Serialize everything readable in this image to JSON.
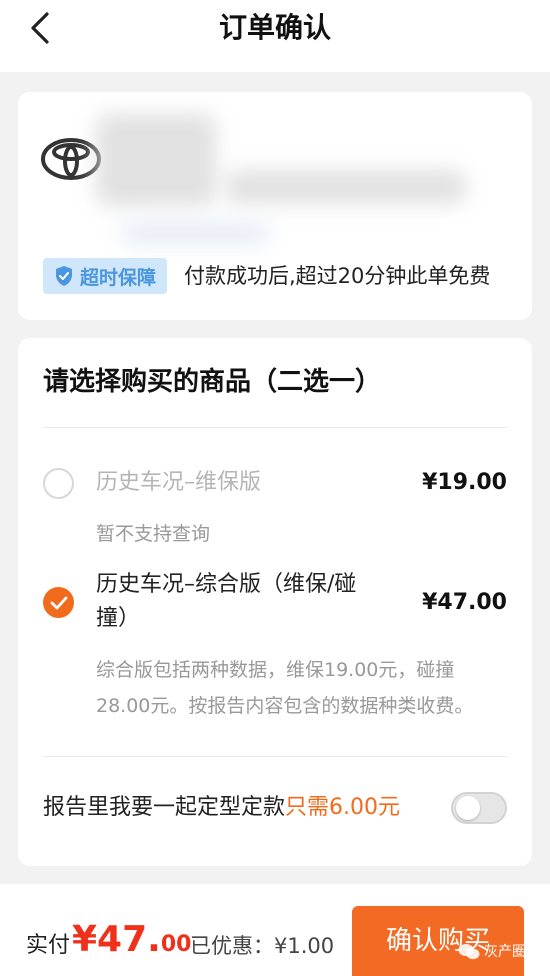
{
  "header": {
    "title": "订单确认"
  },
  "product": {
    "guarantee_badge": "超时保障",
    "guarantee_desc": "付款成功后,超过20分钟此单免费"
  },
  "selection": {
    "title": "请选择购买的商品（二选一）",
    "options": [
      {
        "name": "历史车况–维保版",
        "price": "¥19.00",
        "note": "暂不支持查询",
        "selected": false,
        "disabled": true
      },
      {
        "name_line1": "历史车况–综合版（维保/碰",
        "name_line2": "撞）",
        "price": "¥47.00",
        "desc_line1": "综合版包括两种数据，维保19.00元，碰撞",
        "desc_line2": "28.00元。按报告内容包含的数据种类收费。",
        "selected": true,
        "disabled": false
      }
    ],
    "style_addon": {
      "label": "报告里我要一起定型定款",
      "price_text": "只需6.00元",
      "enabled": false
    }
  },
  "footer": {
    "pay_label": "实付",
    "amount_main": "¥47.",
    "amount_cents": "00",
    "discount": "已优惠：¥1.00",
    "confirm_button": "确认购买"
  },
  "watermark": {
    "text": "灰产圈"
  },
  "colors": {
    "accent": "#f26b1d",
    "price_red": "#f0301b",
    "badge_bg": "#cfe6fb",
    "badge_text": "#4a96df"
  }
}
